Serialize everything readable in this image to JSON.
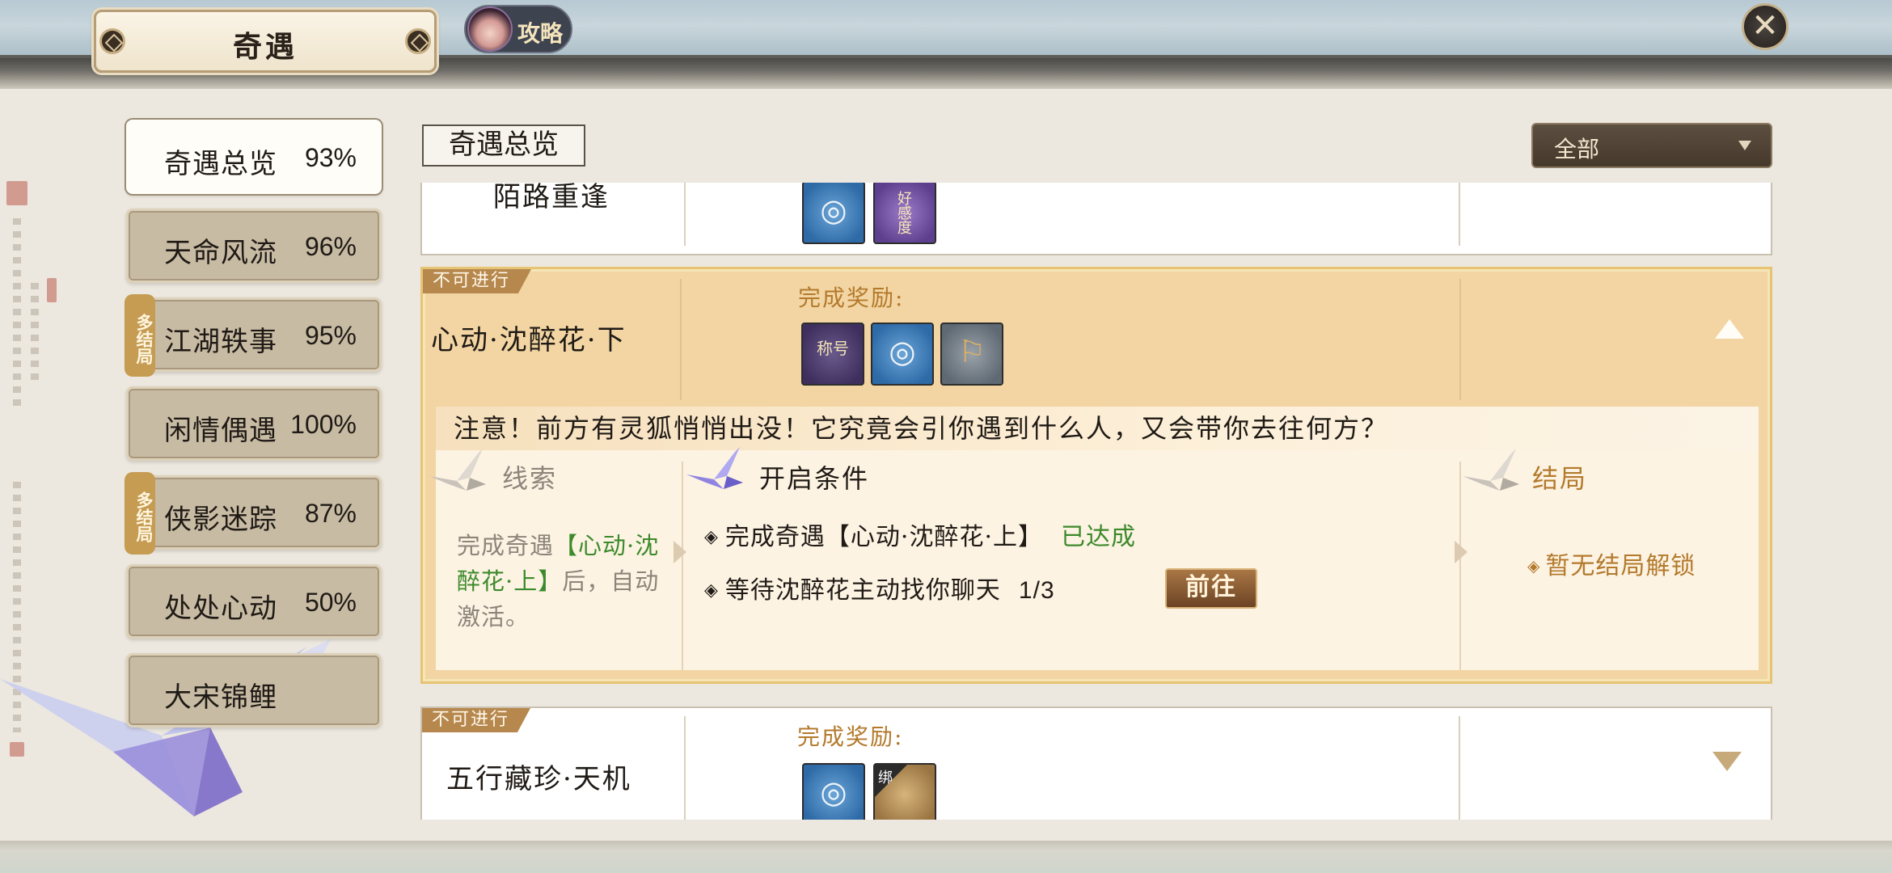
{
  "header": {
    "title": "奇遇",
    "guide_label": "攻略",
    "close_glyph": "✕"
  },
  "sidebar": {
    "items": [
      {
        "label": "奇遇总览",
        "pct": "93%",
        "active": true,
        "multi": ""
      },
      {
        "label": "天命风流",
        "pct": "96%",
        "active": false,
        "multi": ""
      },
      {
        "label": "江湖轶事",
        "pct": "95%",
        "active": false,
        "multi": "多结局"
      },
      {
        "label": "闲情偶遇",
        "pct": "100%",
        "active": false,
        "multi": ""
      },
      {
        "label": "侠影迷踪",
        "pct": "87%",
        "active": false,
        "multi": "多结局"
      },
      {
        "label": "处处心动",
        "pct": "50%",
        "active": false,
        "multi": ""
      },
      {
        "label": "大宋锦鲤",
        "pct": "",
        "active": false,
        "multi": ""
      }
    ]
  },
  "main": {
    "section_tab": "奇遇总览",
    "filter": {
      "value": "全部"
    },
    "cards": {
      "top": {
        "name": "陌路重逢",
        "item1": "◎",
        "item2": "好感度"
      },
      "expanded": {
        "badge": "不可进行",
        "name": "心动·沈醉花·下",
        "reward_title": "完成奖励:",
        "items": [
          "称号",
          "◎",
          "⚐"
        ],
        "notice": "注意！前方有灵狐悄悄出没！它究竟会引你遇到什么人，又会带你去往何方？",
        "clue_title": "线索",
        "clue_pre": "完成奇遇",
        "clue_hl": "【心动·沈醉花·上】",
        "clue_post": "后，自动激活。",
        "cond_title": "开启条件",
        "cond1": "完成奇遇【心动·沈醉花·上】",
        "cond1_status": "已达成",
        "cond2": "等待沈醉花主动找你聊天",
        "cond2_progress": "1/3",
        "go_label": "前往",
        "ending_title": "结局",
        "ending_text": "暂无结局解锁"
      },
      "bottom": {
        "badge": "不可进行",
        "name": "五行藏珍·天机",
        "reward_title": "完成奖励:",
        "item2_tag": "绑"
      }
    }
  },
  "colors": {
    "accent_gold": "#b37a2c",
    "done_green": "#3c8a2b",
    "expanded_bg": "#f2d5a3"
  }
}
